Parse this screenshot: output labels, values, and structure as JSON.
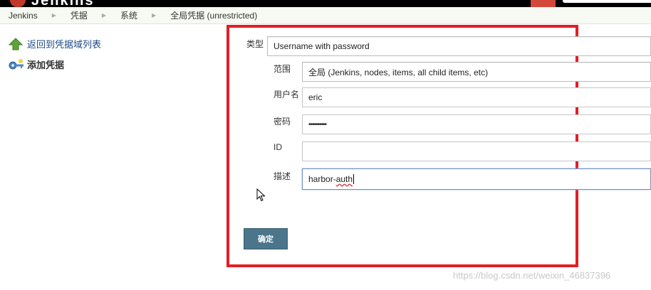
{
  "header": {
    "title_fragment": "Jenkins"
  },
  "breadcrumb": {
    "items": [
      "Jenkins",
      "凭据",
      "系统",
      "全局凭据 (unrestricted)"
    ]
  },
  "sidebar": {
    "back_label": "返回到凭据域列表",
    "add_label": "添加凭据"
  },
  "form": {
    "kind_label": "类型",
    "kind_value": "Username with password",
    "scope_label": "范围",
    "scope_value": "全局 (Jenkins, nodes, items, all child items, etc)",
    "username_label": "用户名",
    "username_value": "eric",
    "password_label": "密码",
    "password_value": "••••••••••",
    "id_label": "ID",
    "id_value": "",
    "description_label": "描述",
    "description_prefix": "harbor-",
    "description_misspelled": "auth",
    "ok_label": "确定"
  },
  "watermark": "https://blog.csdn.net/weixin_46837396",
  "colors": {
    "highlight_border": "#e31e24",
    "ok_button": "#4b758b",
    "header": "#000000"
  }
}
